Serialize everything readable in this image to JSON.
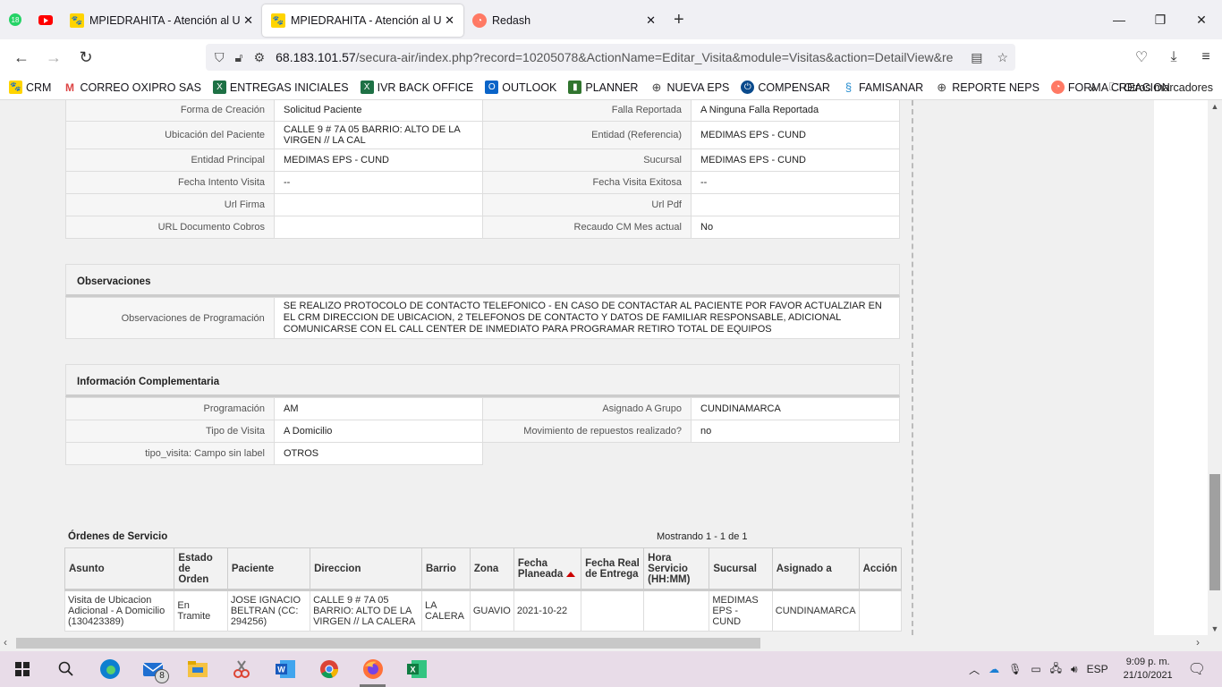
{
  "browser": {
    "pinned_badge": "18",
    "tabs": [
      {
        "title": "MPIEDRAHITA - Atención al Usuario",
        "active": false
      },
      {
        "title": "MPIEDRAHITA - Atención al Usuario",
        "active": true
      },
      {
        "title": "Redash",
        "active": false
      }
    ],
    "url_host": "68.183.101.57",
    "url_path": "/secura-air/index.php?record=10205078&ActionName=Editar_Visita&module=Visitas&action=DetailView&re",
    "bookmarks": [
      "CRM",
      "CORREO OXIPRO SAS",
      "ENTREGAS INICIALES",
      "IVR BACK OFFICE",
      "OUTLOOK",
      "PLANNER",
      "NUEVA EPS",
      "COMPENSAR",
      "FAMISANAR",
      "REPORTE NEPS",
      "FORMA CREACION"
    ],
    "other_bookmarks": "Otros marcadores"
  },
  "detail": {
    "rows": [
      {
        "l1": "Forma de Creación",
        "v1": "Solicitud Paciente",
        "l2": "Falla Reportada",
        "v2": "A Ninguna Falla Reportada"
      },
      {
        "l1": "Ubicación del Paciente",
        "v1": "CALLE 9 # 7A 05 BARRIO: ALTO DE LA VIRGEN // LA CAL",
        "l2": "Entidad (Referencia)",
        "v2": "MEDIMAS EPS - CUND"
      },
      {
        "l1": "Entidad Principal",
        "v1": "MEDIMAS EPS - CUND",
        "l2": "Sucursal",
        "v2": "MEDIMAS EPS - CUND"
      },
      {
        "l1": "Fecha Intento Visita",
        "v1": "--",
        "l2": "Fecha Visita Exitosa",
        "v2": "--"
      },
      {
        "l1": "Url Firma",
        "v1": "",
        "l2": "Url Pdf",
        "v2": ""
      },
      {
        "l1": "URL Documento Cobros",
        "v1": "",
        "l2": "Recaudo CM Mes actual",
        "v2": "No"
      }
    ]
  },
  "observaciones": {
    "title": "Observaciones",
    "label": "Observaciones de Programación",
    "value": " SE REALIZO PROTOCOLO DE CONTACTO TELEFONICO - EN CASO DE CONTACTAR AL PACIENTE POR FAVOR ACTUALZIAR EN EL CRM DIRECCION DE UBICACION, 2 TELEFONOS DE CONTACTO Y DATOS DE FAMILIAR RESPONSABLE, ADICIONAL COMUNICARSE CON EL CALL CENTER DE INMEDIATO PARA PROGRAMAR RETIRO TOTAL DE EQUIPOS"
  },
  "complementaria": {
    "title": "Información Complementaria",
    "rows": [
      {
        "l1": "Programación",
        "v1": "AM",
        "l2": "Asignado A Grupo",
        "v2": "CUNDINAMARCA"
      },
      {
        "l1": "Tipo de Visita",
        "v1": "A Domicilio",
        "l2": "Movimiento de repuestos realizado?",
        "v2": "no"
      },
      {
        "l1": "tipo_visita: Campo sin label",
        "v1": "OTROS"
      }
    ]
  },
  "ordenes": {
    "title": "Órdenes de Servicio",
    "count": "Mostrando 1 - 1 de 1",
    "headers": [
      "Asunto",
      "Estado de Orden",
      "Paciente",
      "Direccion",
      "Barrio",
      "Zona",
      "Fecha Planeada",
      "Fecha Real de Entrega",
      "Hora Servicio (HH:MM)",
      "Sucursal",
      "Asignado a",
      "Acción"
    ],
    "rows": [
      [
        "Visita de Ubicacion Adicional - A Domicilio (130423389)",
        "En Tramite",
        "JOSE IGNACIO BELTRAN (CC: 294256)",
        "CALLE 9 # 7A 05 BARRIO: ALTO DE LA VIRGEN // LA CALERA",
        "LA CALERA",
        "GUAVIO",
        "2021-10-22",
        "",
        "",
        "MEDIMAS EPS - CUND",
        "CUNDINAMARCA",
        ""
      ]
    ]
  },
  "taskbar": {
    "mail_badge": "8",
    "lang": "ESP",
    "time": "9:09 p. m.",
    "date": "21/10/2021"
  }
}
